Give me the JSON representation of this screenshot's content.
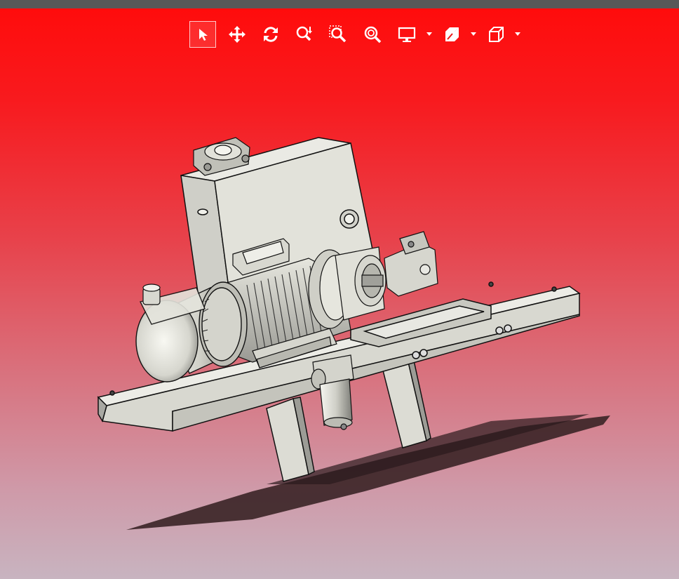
{
  "window": {
    "title": ""
  },
  "toolbar": {
    "buttons": [
      {
        "name": "select-button",
        "icon": "select-arrow-icon",
        "active": true
      },
      {
        "name": "pan-button",
        "icon": "pan-move-icon",
        "active": false
      },
      {
        "name": "rotate-button",
        "icon": "rotate-icon",
        "active": false
      },
      {
        "name": "zoom-button",
        "icon": "zoom-in-out-icon",
        "active": false
      },
      {
        "name": "zoom-window-button",
        "icon": "zoom-window-icon",
        "active": false
      },
      {
        "name": "zoom-fit-button",
        "icon": "zoom-fit-icon",
        "active": false
      },
      {
        "name": "display-mode-button",
        "icon": "monitor-icon",
        "active": false,
        "has_dropdown": true
      },
      {
        "name": "section-view-button",
        "icon": "section-cube-icon",
        "active": false,
        "has_dropdown": true
      },
      {
        "name": "standard-views-button",
        "icon": "view-cube-icon",
        "active": false,
        "has_dropdown": true
      }
    ]
  },
  "viewport": {
    "background_top": "#ff0c0c",
    "background_bottom": "#c8b4c0",
    "model": "hydraulic-power-unit",
    "shadow_color": "#3a2326"
  }
}
